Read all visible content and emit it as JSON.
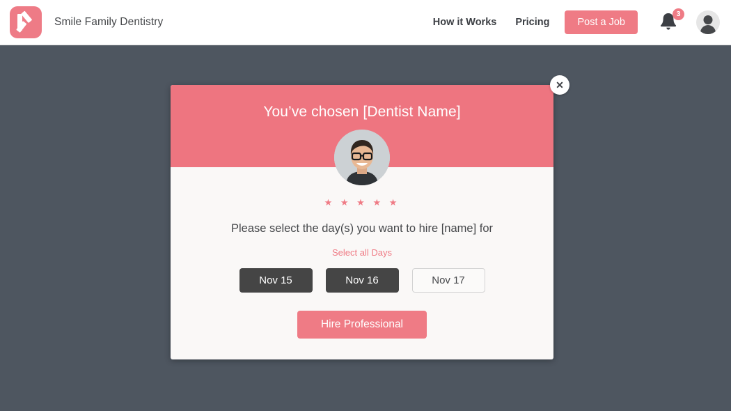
{
  "navbar": {
    "brand_name": "Smile Family Dentistry",
    "logo_icon": "k-logo-icon",
    "links": [
      {
        "label": "How it Works"
      },
      {
        "label": "Pricing"
      }
    ],
    "post_job_label": "Post a Job",
    "bell_icon": "notification-bell-icon",
    "notification_count": "3",
    "avatar_icon": "user-avatar-icon"
  },
  "modal": {
    "title": "You’ve chosen [Dentist Name]",
    "close_label": "✕",
    "close_icon": "close-icon",
    "profile_photo_icon": "dentist-profile-photo",
    "rating_stars": "★ ★ ★ ★ ★",
    "rating_value": "5",
    "prompt": "Please select the day(s) you want to hire [name] for",
    "select_all_label": "Select all Days",
    "days": [
      {
        "label": "Nov 15",
        "selected": true
      },
      {
        "label": "Nov 16",
        "selected": true
      },
      {
        "label": "Nov 17",
        "selected": false
      }
    ],
    "hire_label": "Hire Professional"
  },
  "colors": {
    "accent_pink": "#ef7b85",
    "header_pink": "#ee7580",
    "page_background": "#4e5660",
    "modal_background": "#faf8f7",
    "selected_day": "#454545"
  }
}
